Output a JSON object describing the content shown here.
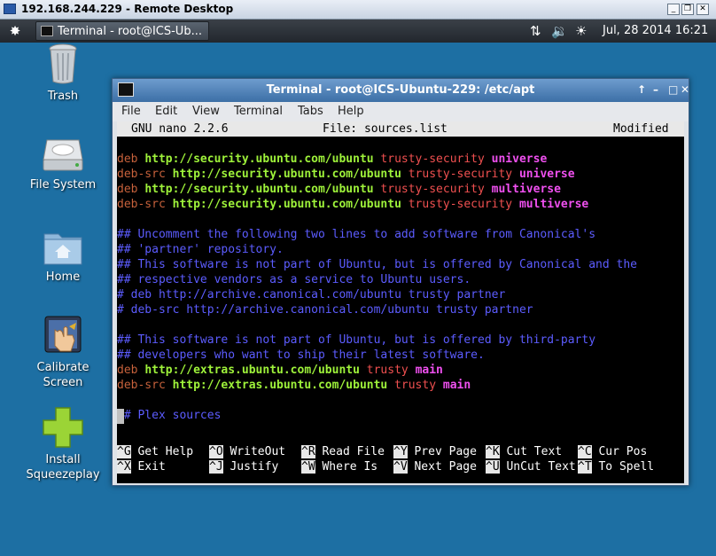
{
  "rdp": {
    "title": "192.168.244.229 - Remote Desktop"
  },
  "taskbar": {
    "task_label": "Terminal - root@ICS-Ub...",
    "clock": "Jul, 28  2014 16:21"
  },
  "desktop": {
    "icons": [
      {
        "label": "Trash",
        "icon": "trash-icon"
      },
      {
        "label": "File System",
        "icon": "hard-drive-icon"
      },
      {
        "label": "Home",
        "icon": "home-folder-icon"
      },
      {
        "label": "Calibrate\nScreen",
        "icon": "calibrate-screen-icon"
      },
      {
        "label": "Install\nSqueezeplay",
        "icon": "plus-icon"
      }
    ]
  },
  "terminal": {
    "title": "Terminal - root@ICS-Ubuntu-229: /etc/apt",
    "menu": [
      "File",
      "Edit",
      "View",
      "Terminal",
      "Tabs",
      "Help"
    ]
  },
  "nano": {
    "version": "GNU nano 2.2.6",
    "file": "File: sources.list",
    "status": "Modified",
    "lines": [
      [],
      [
        [
          "deb ",
          "org"
        ],
        [
          "http://security.ubuntu.com/ubuntu ",
          "grn"
        ],
        [
          "trusty-security ",
          "red"
        ],
        [
          "universe",
          "mag"
        ]
      ],
      [
        [
          "deb-src ",
          "org"
        ],
        [
          "http://security.ubuntu.com/ubuntu ",
          "grn"
        ],
        [
          "trusty-security ",
          "red"
        ],
        [
          "universe",
          "mag"
        ]
      ],
      [
        [
          "deb ",
          "org"
        ],
        [
          "http://security.ubuntu.com/ubuntu ",
          "grn"
        ],
        [
          "trusty-security ",
          "red"
        ],
        [
          "multiverse",
          "mag"
        ]
      ],
      [
        [
          "deb-src ",
          "org"
        ],
        [
          "http://security.ubuntu.com/ubuntu ",
          "grn"
        ],
        [
          "trusty-security ",
          "red"
        ],
        [
          "multiverse",
          "mag"
        ]
      ],
      [],
      [
        [
          "## Uncomment the following two lines to add software from Canonical's",
          "blu"
        ]
      ],
      [
        [
          "## 'partner' repository.",
          "blu"
        ]
      ],
      [
        [
          "## This software is not part of Ubuntu, but is offered by Canonical and the",
          "blu"
        ]
      ],
      [
        [
          "## respective vendors as a service to Ubuntu users.",
          "blu"
        ]
      ],
      [
        [
          "# deb http://archive.canonical.com/ubuntu trusty partner",
          "blu"
        ]
      ],
      [
        [
          "# deb-src http://archive.canonical.com/ubuntu trusty partner",
          "blu"
        ]
      ],
      [],
      [
        [
          "## This software is not part of Ubuntu, but is offered by third-party",
          "blu"
        ]
      ],
      [
        [
          "## developers who want to ship their latest software.",
          "blu"
        ]
      ],
      [
        [
          "deb ",
          "org"
        ],
        [
          "http://extras.ubuntu.com/ubuntu ",
          "grn"
        ],
        [
          "trusty ",
          "red"
        ],
        [
          "main",
          "mag"
        ]
      ],
      [
        [
          "deb-src ",
          "org"
        ],
        [
          "http://extras.ubuntu.com/ubuntu ",
          "grn"
        ],
        [
          "trusty ",
          "red"
        ],
        [
          "main",
          "mag"
        ]
      ],
      [],
      [
        [
          "## Plex sources",
          "blu"
        ]
      ]
    ],
    "shortcuts": [
      {
        "key": "^G",
        "label": "Get Help"
      },
      {
        "key": "^O",
        "label": "WriteOut"
      },
      {
        "key": "^R",
        "label": "Read File"
      },
      {
        "key": "^Y",
        "label": "Prev Page"
      },
      {
        "key": "^K",
        "label": "Cut Text"
      },
      {
        "key": "^C",
        "label": "Cur Pos"
      },
      {
        "key": "^X",
        "label": "Exit"
      },
      {
        "key": "^J",
        "label": "Justify"
      },
      {
        "key": "^W",
        "label": "Where Is"
      },
      {
        "key": "^V",
        "label": "Next Page"
      },
      {
        "key": "^U",
        "label": "UnCut Text"
      },
      {
        "key": "^T",
        "label": "To Spell"
      }
    ]
  }
}
